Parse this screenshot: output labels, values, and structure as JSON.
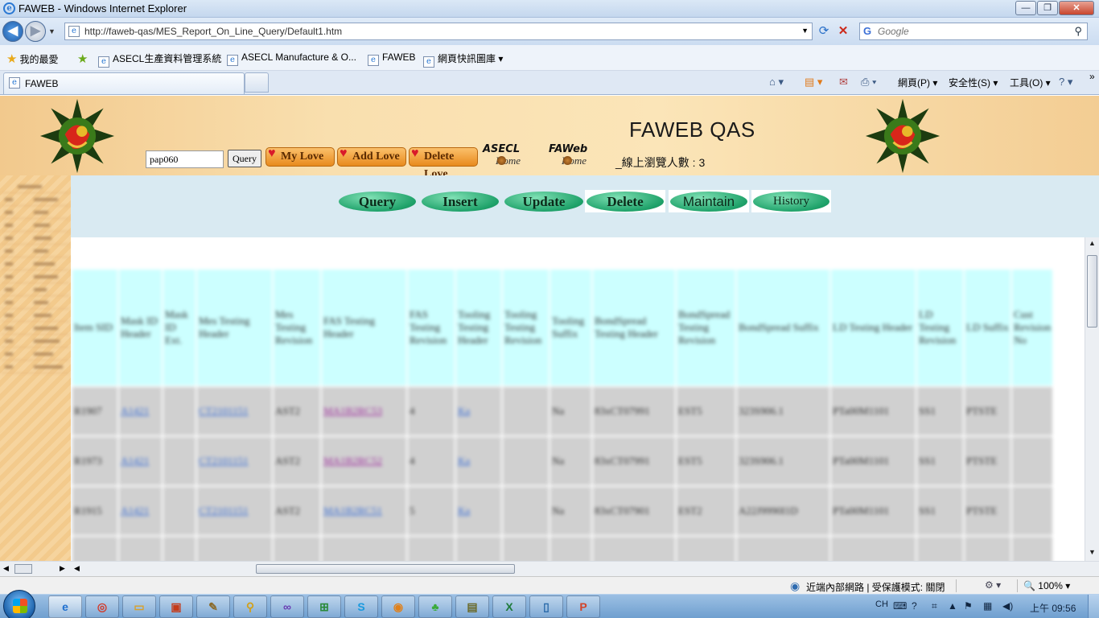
{
  "window": {
    "title": "FAWEB - Windows Internet Explorer",
    "min": "—",
    "max": "❐",
    "close": "✕"
  },
  "address": {
    "url": "http://faweb-qas/MES_Report_On_Line_Query/Default1.htm",
    "search_placeholder": "Google"
  },
  "favorites": {
    "label": "我的最愛",
    "items": [
      "ASECL生產資料管理系統",
      "ASECL Manufacture & O...",
      "FAWEB",
      "網頁快訊圖庫 ▾"
    ]
  },
  "tabs": [
    {
      "label": "FAWEB"
    }
  ],
  "commandbar": {
    "page": "網頁(P) ▾",
    "safety": "安全性(S) ▾",
    "tools": "工具(O) ▾",
    "help": "? ▾",
    "more": "»"
  },
  "banner": {
    "title": "FAWEB QAS",
    "user_value": "pap060",
    "query_small": "Query",
    "my_love": "My Love",
    "add_love": "Add Love",
    "delete_love": "Delete Love",
    "asecl_home_big": "ASECL",
    "asecl_home_small": "Home",
    "faweb_home_big": "FAWeb",
    "faweb_home_small": "Home",
    "online_count": "_線上瀏覽人數 : 3"
  },
  "actions": {
    "query": "Query",
    "insert": "Insert",
    "update": "Update",
    "delete": "Delete",
    "maintain": "Maintain",
    "history": "History"
  },
  "grid": {
    "headers": [
      "Item SID",
      "Mask ID Header",
      "Mask ID Ext.",
      "Mes Testing Header",
      "Mes Testing Revision",
      "FAS Testing Header",
      "FAS Testing Revision",
      "Tooling Testing Header",
      "Tooling Testing Revision",
      "Tooling Suffix",
      "BondSpread Testing Header",
      "BondSpread Testing Revision",
      "BondSpread Suffix",
      "LD Testing Header",
      "LD Testing Revision",
      "LD Suffix",
      "Cust Revision No"
    ],
    "rows": [
      [
        "R1907",
        "A1421",
        "",
        "CT2101151",
        "AST2",
        "MA1B2RC53",
        "4",
        "Ka",
        "",
        "Na",
        "83xCT07991",
        "EST5",
        "323S906.1",
        "PTa00M1101",
        "SS1",
        "PTSTE",
        ""
      ],
      [
        "R1973",
        "A1421",
        "",
        "CT2101151",
        "AST2",
        "MA1B2RC52",
        "4",
        "Ka",
        "",
        "Na",
        "83xCT07991",
        "EST5",
        "323S906.1",
        "PTa00M1101",
        "SS1",
        "PTSTE",
        ""
      ],
      [
        "R1915",
        "A1421",
        "",
        "CT2101151",
        "AST2",
        "MA1B2RC51",
        "5",
        "Ka",
        "",
        "Na",
        "83xCT07901",
        "EST2",
        "A22J9990I1D",
        "PTa00M1101",
        "SS1",
        "PTSTE",
        ""
      ],
      [
        "",
        "",
        "",
        "",
        "",
        "",
        "",
        "",
        "",
        "",
        "",
        "",
        "",
        "",
        "",
        "",
        ""
      ]
    ]
  },
  "status": {
    "zone": "近端內部網路 | 受保護模式: 關閉",
    "zoom": "🔍 100% ▾"
  },
  "taskbar": {
    "lang": "CH",
    "clock": "上午 09:56"
  }
}
